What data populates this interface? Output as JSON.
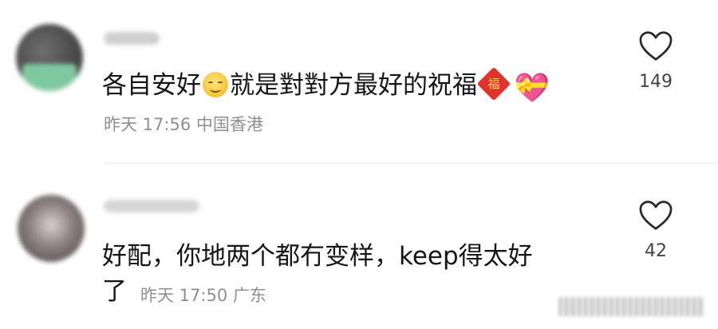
{
  "comments": [
    {
      "text_before": "各自安好",
      "text_after": "就是對對方最好的祝福",
      "emoji_smile": "relieved-face-icon",
      "emoji_fu": "福",
      "emoji_heart": "💝",
      "time": "昨天 17:56",
      "location": "中国香港",
      "likes": "149"
    },
    {
      "text_line1": "好配，你地两个都冇变样，keep得太好",
      "text_line2": "了",
      "time": "昨天 17:50",
      "location": "广东",
      "likes": "42"
    }
  ]
}
